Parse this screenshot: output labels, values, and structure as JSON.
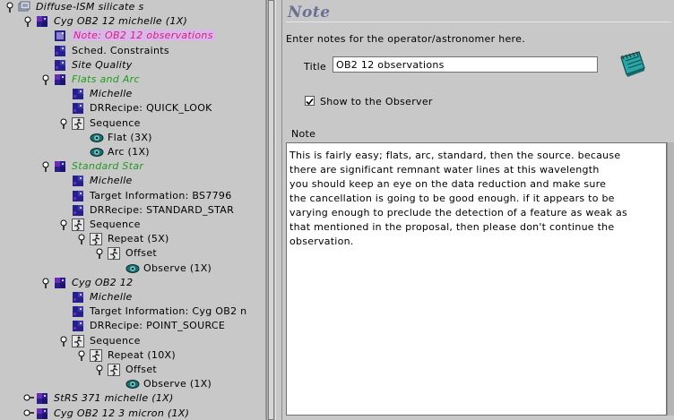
{
  "tree": {
    "rows": [
      {
        "label": "Diffuse-ISM silicate s",
        "indent": 0,
        "toggle": "open",
        "icon": "folder-icon",
        "style": "it"
      },
      {
        "label": "Cyg OB2 12 michelle (1X)",
        "indent": 1,
        "toggle": "open",
        "icon": "observation-icon",
        "style": "it"
      },
      {
        "label": "Note: OB2 12 observations",
        "indent": 2,
        "toggle": "none",
        "icon": "note-icon",
        "style": "it pink",
        "selected": true
      },
      {
        "label": "Sched. Constraints",
        "indent": 2,
        "toggle": "none",
        "icon": "component-icon",
        "style": ""
      },
      {
        "label": "Site Quality",
        "indent": 2,
        "toggle": "none",
        "icon": "component-icon",
        "style": "it"
      },
      {
        "label": "Flats and Arc",
        "indent": 2,
        "toggle": "open",
        "icon": "observation-icon",
        "style": "it green"
      },
      {
        "label": "Michelle",
        "indent": 3,
        "toggle": "none",
        "icon": "component-icon",
        "style": "it"
      },
      {
        "label": "DRRecipe: QUICK_LOOK",
        "indent": 3,
        "toggle": "none",
        "icon": "component-icon",
        "style": ""
      },
      {
        "label": "Sequence",
        "indent": 3,
        "toggle": "open",
        "icon": "sequence-icon",
        "style": ""
      },
      {
        "label": "Flat (3X)",
        "indent": 4,
        "toggle": "none",
        "icon": "eye-icon",
        "style": ""
      },
      {
        "label": "Arc (1X)",
        "indent": 4,
        "toggle": "none",
        "icon": "eye-icon",
        "style": ""
      },
      {
        "label": "Standard Star",
        "indent": 2,
        "toggle": "open",
        "icon": "observation-icon",
        "style": "it green"
      },
      {
        "label": "Michelle",
        "indent": 3,
        "toggle": "none",
        "icon": "component-icon",
        "style": "it"
      },
      {
        "label": "Target Information: BS7796",
        "indent": 3,
        "toggle": "none",
        "icon": "component-icon",
        "style": ""
      },
      {
        "label": "DRRecipe: STANDARD_STAR",
        "indent": 3,
        "toggle": "none",
        "icon": "component-icon",
        "style": ""
      },
      {
        "label": "Sequence",
        "indent": 3,
        "toggle": "open",
        "icon": "sequence-icon",
        "style": ""
      },
      {
        "label": "Repeat (5X)",
        "indent": 4,
        "toggle": "open",
        "icon": "sequence-icon",
        "style": ""
      },
      {
        "label": "Offset",
        "indent": 5,
        "toggle": "open",
        "icon": "sequence-icon",
        "style": ""
      },
      {
        "label": "Observe (1X)",
        "indent": 6,
        "toggle": "none",
        "icon": "eye-icon",
        "style": ""
      },
      {
        "label": "Cyg OB2 12",
        "indent": 2,
        "toggle": "open",
        "icon": "observation-icon",
        "style": "it"
      },
      {
        "label": "Michelle",
        "indent": 3,
        "toggle": "none",
        "icon": "component-icon",
        "style": "it"
      },
      {
        "label": "Target Information: Cyg OB2 n",
        "indent": 3,
        "toggle": "none",
        "icon": "component-icon",
        "style": ""
      },
      {
        "label": "DRRecipe: POINT_SOURCE",
        "indent": 3,
        "toggle": "none",
        "icon": "component-icon",
        "style": ""
      },
      {
        "label": "Sequence",
        "indent": 3,
        "toggle": "open",
        "icon": "sequence-icon",
        "style": ""
      },
      {
        "label": "Repeat (10X)",
        "indent": 4,
        "toggle": "open",
        "icon": "sequence-icon",
        "style": ""
      },
      {
        "label": "Offset",
        "indent": 5,
        "toggle": "open",
        "icon": "sequence-icon",
        "style": ""
      },
      {
        "label": "Observe (1X)",
        "indent": 6,
        "toggle": "none",
        "icon": "eye-icon",
        "style": ""
      },
      {
        "label": "StRS 371 michelle (1X)",
        "indent": 1,
        "toggle": "closed",
        "icon": "observation-icon",
        "style": "it"
      },
      {
        "label": "Cyg OB2 12 3 micron (1X)",
        "indent": 1,
        "toggle": "closed",
        "icon": "observation-icon",
        "style": "it"
      }
    ]
  },
  "note_editor": {
    "panel_title": "Note",
    "description": "Enter notes for the operator/astronomer here.",
    "title_label": "Title",
    "title_value": "OB2 12 observations",
    "show_checkbox_label": "Show to the Observer",
    "show_checked": true,
    "note_label": "Note",
    "note_lines": [
      "This is fairly easy; flats, arc, standard, then the source. because",
      "there are significant remnant water lines at this wavelength",
      "you should keep an eye on the data reduction and make sure",
      "the cancellation is going to be good enough. if it appears to be",
      "varying enough to preclude the detection of a feature as weak as",
      "that mentioned in the proposal, then please don't continue the",
      "observation."
    ]
  },
  "colors": {
    "background": "#c8c8c8",
    "panel_title": "#6b6f96",
    "green_label": "#1e9c1e",
    "note_label": "#e01a80",
    "selection": "#d8b8e8"
  }
}
